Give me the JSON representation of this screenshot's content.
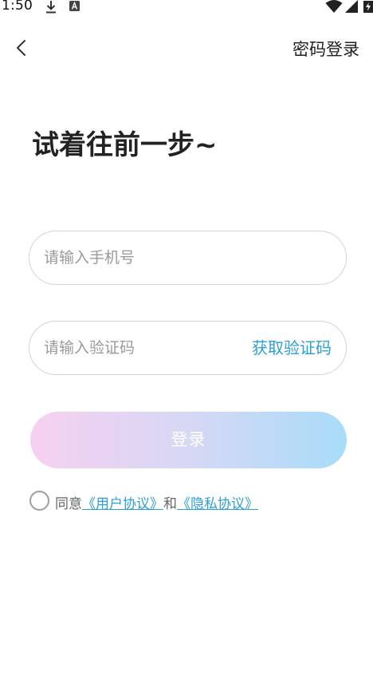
{
  "status_bar": {
    "time": "1:50",
    "icons": [
      "download-icon",
      "a-icon",
      "wifi-icon",
      "signal-icon",
      "battery-icon"
    ]
  },
  "header": {
    "back_icon": "chevron-left-icon",
    "action_label": "密码登录"
  },
  "title": "试着往前一步~",
  "form": {
    "phone_placeholder": "请输入手机号",
    "code_placeholder": "请输入验证码",
    "get_code_label": "获取验证码",
    "login_label": "登录"
  },
  "agreement": {
    "agree_text": "同意",
    "user_agreement": "《用户协议》",
    "and_text": "和",
    "privacy_policy": "《隐私协议》"
  },
  "colors": {
    "accent": "#2b9fd8",
    "login_gradient_start": "#f7d0f0",
    "login_gradient_end": "#a8dcf8",
    "border": "#d3d3d3"
  }
}
